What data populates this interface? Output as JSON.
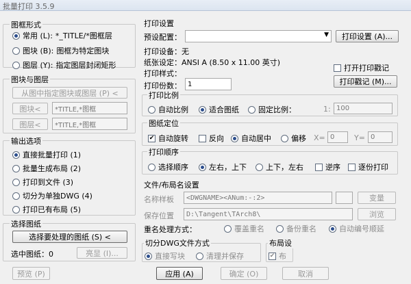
{
  "window": {
    "title": "批量打印 3.5.9"
  },
  "frame_type": {
    "title": "图框形式",
    "options": [
      {
        "label": "常用 (L):",
        "value": "*_TITLE/*图框层",
        "selected": true
      },
      {
        "label": "图块 (B):",
        "value": "图框为特定图块",
        "selected": false
      },
      {
        "label": "图层 (Y):",
        "value": "指定图层封闭矩形",
        "selected": false
      }
    ]
  },
  "block_layer": {
    "title": "图块与图层",
    "pick_button": "从图中指定图块或图层 (P) <",
    "block_button": "图块<",
    "block_value": "*TITLE,*图框",
    "layer_button": "图层<",
    "layer_value": "*TITLE,*图框"
  },
  "output": {
    "title": "输出选项",
    "options": [
      {
        "label": "直接批量打印 (1)",
        "selected": true
      },
      {
        "label": "批量生成布局 (2)",
        "selected": false
      },
      {
        "label": "打印到文件 (3)",
        "selected": false
      },
      {
        "label": "切分为单独DWG (4)",
        "selected": false
      },
      {
        "label": "打印已有布局 (5)",
        "selected": false
      }
    ]
  },
  "select": {
    "title": "选择图纸",
    "button": "选择要处理的图纸 (S) <",
    "selected_label": "选中图纸：0",
    "highlight_button": "亮显 (I)..."
  },
  "print_settings": {
    "title": "打印设置",
    "preset_label": "预设配置：",
    "preset_value": "",
    "settings_button": "打印设置 (A)...",
    "device_label": "打印设备：无",
    "paper_label": "纸张设定：ANSI A (8.50 x 11.00 英寸)",
    "style_label": "打印样式：",
    "open_stamp_label": "打开打印戳记",
    "copies_label": "打印份数：",
    "copies_value": "1",
    "stamp_button": "打印戳记 (M)..."
  },
  "scale": {
    "title": "打印比例",
    "options": [
      {
        "label": "自动比例",
        "selected": false
      },
      {
        "label": "适合图纸",
        "selected": true
      },
      {
        "label": "固定比例：",
        "selected": false
      }
    ],
    "ratio_prefix": "1:",
    "ratio_value": "100"
  },
  "position": {
    "title": "图纸定位",
    "auto_rotate": "自动旋转",
    "auto_rotate_checked": true,
    "reverse": "反向",
    "reverse_checked": false,
    "center_label": "自动居中",
    "offset_label": "偏移",
    "x_label": "X=",
    "x_value": "0",
    "y_label": "Y=",
    "y_value": "0"
  },
  "order": {
    "title": "打印顺序",
    "options": [
      {
        "label": "选择顺序",
        "selected": false
      },
      {
        "label": "左右，上下",
        "selected": true
      },
      {
        "label": "上下，左右",
        "selected": false
      }
    ],
    "reverse_label": "逆序",
    "per_copy_label": "逐份打印"
  },
  "file_names": {
    "title": "文件/布局名设置",
    "name_format_label": "名称样板",
    "name_format_value": "<DWGNAME><ANum:-:2>",
    "change_button": "变量",
    "save_path_label": "保存位置",
    "save_path_value": "D:\\Tangent\\TArch8\\",
    "browse_button": "浏览",
    "rename_label": "重名处理方式：",
    "rename_options": [
      {
        "label": "覆盖重名",
        "selected": false
      },
      {
        "label": "备份重名",
        "selected": false
      },
      {
        "label": "自动编号顺延",
        "selected": true
      }
    ]
  },
  "split": {
    "title": "切分DWG文件方式",
    "options": [
      {
        "label": "直接写块",
        "selected": true
      },
      {
        "label": "清理并保存",
        "selected": false
      }
    ]
  },
  "layout": {
    "title": "布局设",
    "check_label": "布"
  },
  "footer": {
    "preview": "预览 (P)",
    "apply": "应用 (A)",
    "ok": "确定 (O)",
    "cancel": "取消"
  }
}
